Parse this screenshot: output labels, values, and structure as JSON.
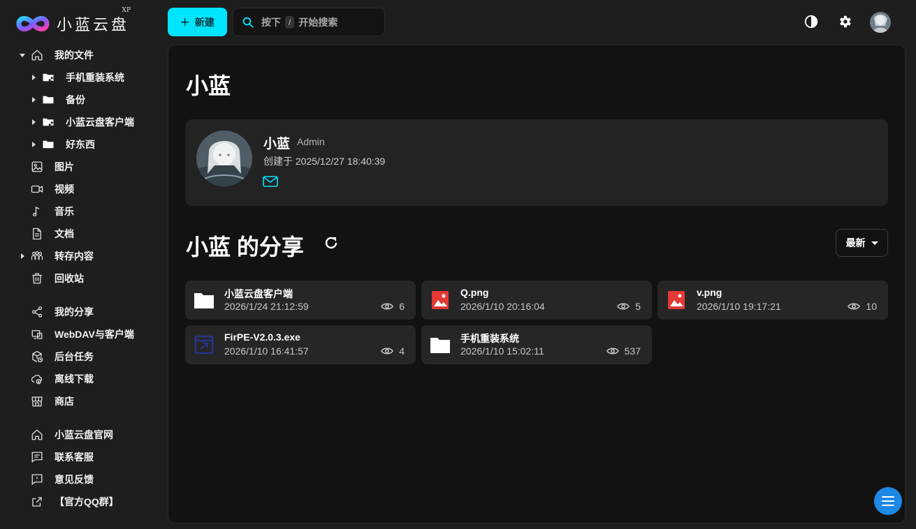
{
  "brand": {
    "name": "小蓝云盘",
    "sup": "XP"
  },
  "sidebar": {
    "items": [
      {
        "label": "我的文件",
        "icon": "home-icon"
      },
      {
        "label": "手机重装系统",
        "icon": "shared-folder-icon"
      },
      {
        "label": "备份",
        "icon": "folder-icon"
      },
      {
        "label": "小蓝云盘客户端",
        "icon": "shared-folder-icon"
      },
      {
        "label": "好东西",
        "icon": "folder-icon"
      },
      {
        "label": "图片",
        "icon": "image-icon"
      },
      {
        "label": "视频",
        "icon": "video-icon"
      },
      {
        "label": "音乐",
        "icon": "music-icon"
      },
      {
        "label": "文档",
        "icon": "document-icon"
      },
      {
        "label": "转存内容",
        "icon": "group-icon"
      },
      {
        "label": "回收站",
        "icon": "trash-icon"
      },
      {
        "label": "我的分享",
        "icon": "share-icon"
      },
      {
        "label": "WebDAV与客户端",
        "icon": "webdav-icon"
      },
      {
        "label": "后台任务",
        "icon": "tasks-icon"
      },
      {
        "label": "离线下载",
        "icon": "cloud-download-icon"
      },
      {
        "label": "商店",
        "icon": "store-icon"
      },
      {
        "label": "小蓝云盘官网",
        "icon": "home-icon"
      },
      {
        "label": "联系客服",
        "icon": "chat-icon"
      },
      {
        "label": "意见反馈",
        "icon": "feedback-icon"
      },
      {
        "label": "【官方QQ群】",
        "icon": "external-link-icon"
      }
    ]
  },
  "topbar": {
    "new_label": "新建",
    "search_prefix": "按下",
    "search_key": "/",
    "search_suffix": "开始搜索"
  },
  "profile": {
    "page_title": "小蓝",
    "name": "小蓝",
    "role": "Admin",
    "created": "创建于 2025/12/27 18:40:39"
  },
  "shares": {
    "title": "小蓝 的分享",
    "sort_label": "最新",
    "items": [
      {
        "name": "小蓝云盘客户端",
        "date": "2026/1/24 21:12:59",
        "views": "6",
        "icon": "folder-icon"
      },
      {
        "name": "Q.png",
        "date": "2026/1/10 20:16:04",
        "views": "5",
        "icon": "image-file-icon"
      },
      {
        "name": "v.png",
        "date": "2026/1/10 19:17:21",
        "views": "10",
        "icon": "image-file-icon"
      },
      {
        "name": "FirPE-V2.0.3.exe",
        "date": "2026/1/10 16:41:57",
        "views": "4",
        "icon": "app-file-icon"
      },
      {
        "name": "手机重装系统",
        "date": "2026/1/10 15:02:11",
        "views": "537",
        "icon": "folder-icon"
      }
    ]
  },
  "colors": {
    "accent": "#00e5ff",
    "fab": "#1e88e5",
    "image_icon": "#e53935",
    "app_icon": "#283593"
  }
}
